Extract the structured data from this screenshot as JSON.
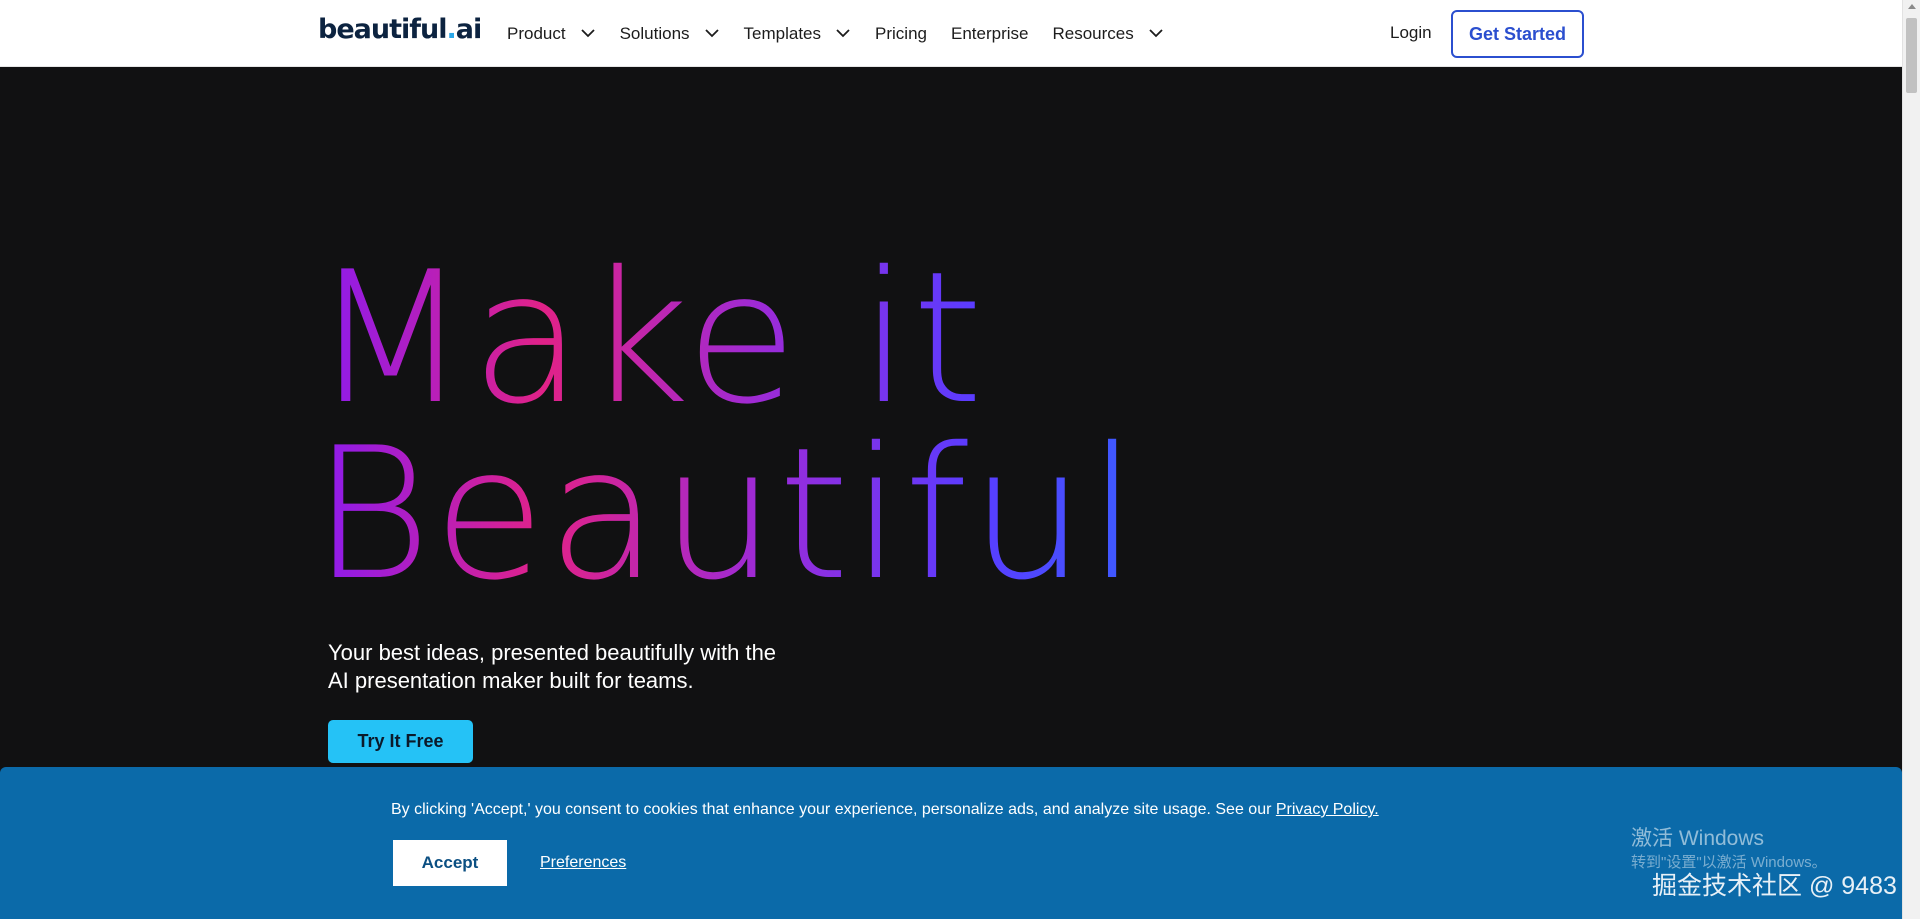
{
  "header": {
    "logo": {
      "text_main": "beautiful",
      "text_dot": ".",
      "text_suffix": "ai"
    },
    "nav": [
      {
        "label": "Product",
        "has_dropdown": true
      },
      {
        "label": "Solutions",
        "has_dropdown": true
      },
      {
        "label": "Templates",
        "has_dropdown": true
      },
      {
        "label": "Pricing",
        "has_dropdown": false
      },
      {
        "label": "Enterprise",
        "has_dropdown": false
      },
      {
        "label": "Resources",
        "has_dropdown": true
      }
    ],
    "login_label": "Login",
    "cta_label": "Get Started"
  },
  "hero": {
    "title_line1": "Make it",
    "title_line2": "Beautiful",
    "subtitle": "Your best ideas, presented beautifully with the AI presentation maker built for teams.",
    "button_label": "Try It Free"
  },
  "cookie_banner": {
    "text": "By clicking 'Accept,' you consent to cookies that enhance your experience, personalize ads, and analyze site usage. See our ",
    "link_label": "Privacy Policy.",
    "accept_label": "Accept",
    "preferences_label": "Preferences"
  },
  "watermark": {
    "title": "激活 Windows",
    "subtitle": "转到\"设置\"以激活 Windows。",
    "community": "掘金技术社区 @ 9483"
  },
  "colors": {
    "brand_blue": "#2b4fcf",
    "cta_cyan": "#25c2f6",
    "banner_blue": "#0b6aa9",
    "hero_bg": "#111112"
  },
  "icons": {
    "dropdown": "chevron-down-icon"
  }
}
